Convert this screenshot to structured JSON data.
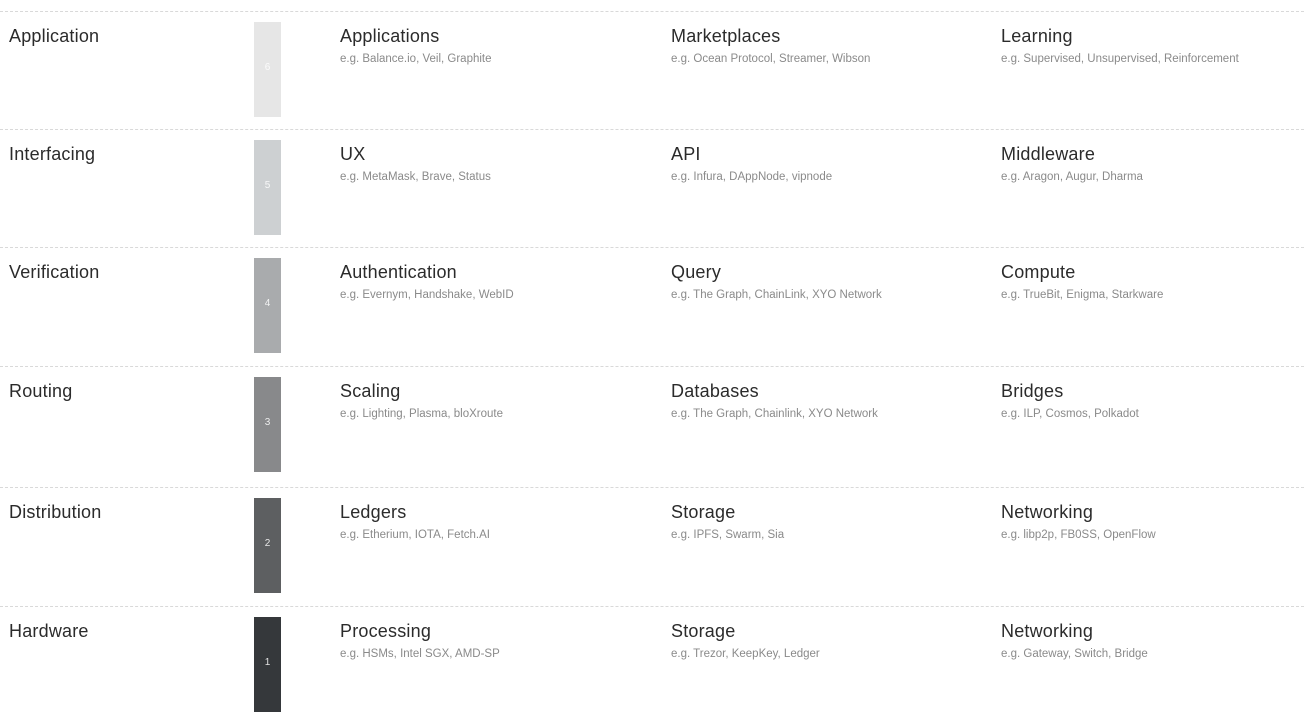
{
  "layers": [
    {
      "name": "Application",
      "number": "6",
      "color": "#e6e6e6",
      "cells": [
        {
          "title": "Applications",
          "examples": "e.g. Balance.io, Veil, Graphite"
        },
        {
          "title": "Marketplaces",
          "examples": "e.g. Ocean Protocol, Streamer, Wibson"
        },
        {
          "title": "Learning",
          "examples": "e.g. Supervised, Unsupervised, Reinforcement"
        }
      ]
    },
    {
      "name": "Interfacing",
      "number": "5",
      "color": "#cdd0d2",
      "cells": [
        {
          "title": "UX",
          "examples": "e.g. MetaMask, Brave, Status"
        },
        {
          "title": "API",
          "examples": "e.g. Infura, DAppNode, vipnode"
        },
        {
          "title": "Middleware",
          "examples": "e.g. Aragon, Augur, Dharma"
        }
      ]
    },
    {
      "name": "Verification",
      "number": "4",
      "color": "#a9abad",
      "cells": [
        {
          "title": "Authentication",
          "examples": "e.g. Evernym, Handshake, WebID"
        },
        {
          "title": "Query",
          "examples": "e.g. The Graph, ChainLink, XYO Network"
        },
        {
          "title": "Compute",
          "examples": "e.g. TrueBit, Enigma, Starkware"
        }
      ]
    },
    {
      "name": "Routing",
      "number": "3",
      "color": "#88898b",
      "cells": [
        {
          "title": "Scaling",
          "examples": "e.g. Lighting, Plasma, bloXroute"
        },
        {
          "title": "Databases",
          "examples": "e.g. The Graph, Chainlink, XYO Network"
        },
        {
          "title": "Bridges",
          "examples": "e.g. ILP, Cosmos, Polkadot"
        }
      ]
    },
    {
      "name": "Distribution",
      "number": "2",
      "color": "#5d5f61",
      "cells": [
        {
          "title": "Ledgers",
          "examples": "e.g. Etherium, IOTA, Fetch.AI"
        },
        {
          "title": "Storage",
          "examples": "e.g. IPFS, Swarm, Sia"
        },
        {
          "title": "Networking",
          "examples": "e.g. libp2p, FB0SS, OpenFlow"
        }
      ]
    },
    {
      "name": "Hardware",
      "number": "1",
      "color": "#35383b",
      "cells": [
        {
          "title": "Processing",
          "examples": "e.g. HSMs, Intel SGX, AMD-SP"
        },
        {
          "title": "Storage",
          "examples": "e.g. Trezor, KeepKey, Ledger"
        },
        {
          "title": "Networking",
          "examples": "e.g. Gateway, Switch, Bridge"
        }
      ]
    }
  ]
}
